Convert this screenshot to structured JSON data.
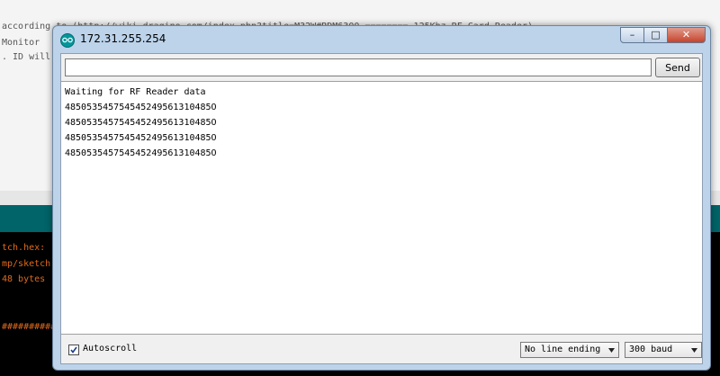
{
  "background_ide": {
    "code_lines": [
      "according to (http://wiki.dragino.com/index.php?title=M32W#RDM6300 ======== 125Khz RF Card Reader)",
      "Monitor",
      ". ID will be"
    ],
    "console_lines": [
      "tch.hex:",
      "mp/sketch.h",
      "48 bytes",
      "###########"
    ]
  },
  "monitor": {
    "title": "172.31.255.254",
    "window_controls": {
      "minimize": "–",
      "maximize": "□",
      "close": "✕"
    },
    "send_input": {
      "value": "",
      "placeholder": ""
    },
    "send_label": "Send",
    "output_lines": [
      "Waiting for RF Reader data",
      "485053545754545249561310485O",
      "485053545754545249561310485O",
      "485053545754545249561310485O",
      "485053545754545249561310485O"
    ],
    "autoscroll": {
      "label": "Autoscroll",
      "checked": true
    },
    "line_ending": {
      "selected": "No line ending"
    },
    "baud": {
      "selected": "300 baud"
    }
  },
  "colors": {
    "accent": "#00979c",
    "status_bar": "#006468",
    "console_text": "#e06a1b"
  }
}
